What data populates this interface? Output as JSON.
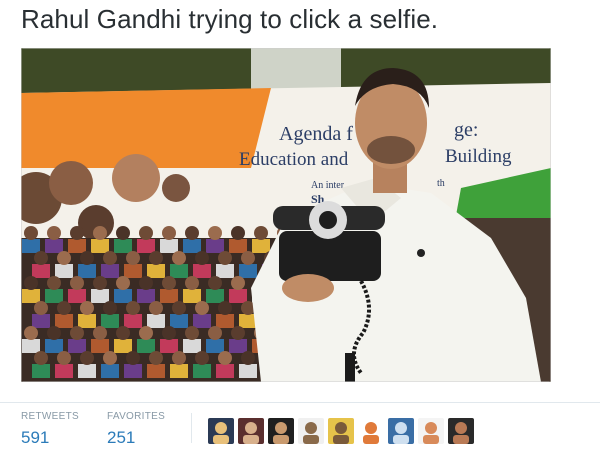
{
  "tweet": {
    "text": "Rahul Gandhi trying to click a selfie."
  },
  "media": {
    "banner_line1": "Agenda f",
    "banner_line1b": "ge:",
    "banner_line2": "Education and",
    "banner_line2b": "Building",
    "banner_line3": "An inter",
    "banner_line3b": "th",
    "banner_line4": "Sh"
  },
  "stats": {
    "retweets_label": "RETWEETS",
    "retweets_count": "591",
    "favorites_label": "FAVORITES",
    "favorites_count": "251"
  },
  "avatars": [
    {
      "icon": "avatar-icon"
    },
    {
      "icon": "avatar-icon"
    },
    {
      "icon": "avatar-icon"
    },
    {
      "icon": "avatar-icon"
    },
    {
      "icon": "avatar-icon"
    },
    {
      "icon": "avatar-icon"
    },
    {
      "icon": "avatar-icon"
    },
    {
      "icon": "avatar-icon"
    },
    {
      "icon": "avatar-icon"
    }
  ],
  "colors": {
    "link_blue": "#2b7bb9",
    "muted_gray": "#8899a6",
    "text_dark": "#292f33"
  }
}
